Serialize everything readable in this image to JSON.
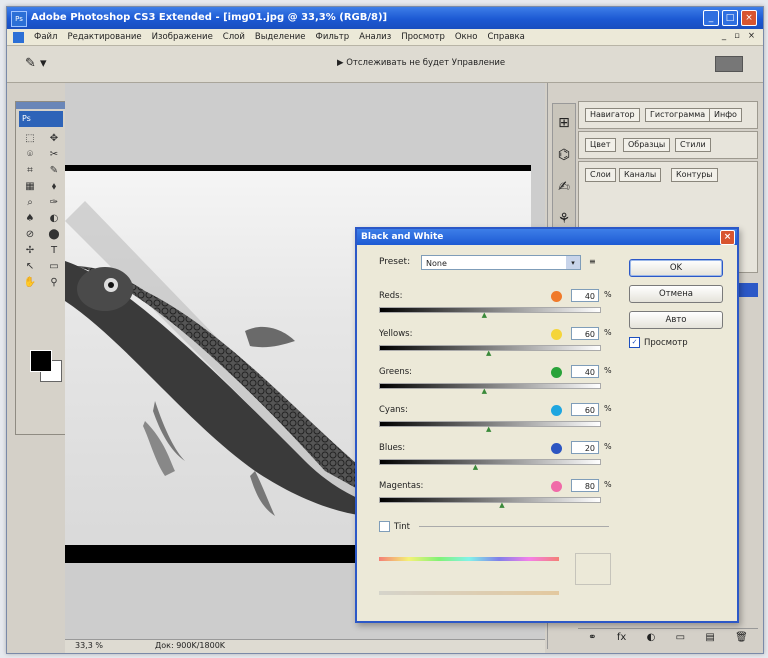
{
  "window": {
    "app_icon": "Ps",
    "title": "Adobe Photoshop CS3 Extended - [img01.jpg @ 33,3% (RGB/8)]",
    "min": "_",
    "max": "□",
    "close": "×"
  },
  "menu": {
    "items": [
      "Файл",
      "Редактирование",
      "Изображение",
      "Слой",
      "Выделение",
      "Фильтр",
      "Анализ",
      "Просмотр",
      "Окно",
      "Справка"
    ],
    "right": [
      "_",
      "▫",
      "×"
    ]
  },
  "options": {
    "tool_glyph": "✎ ▾",
    "hint": "▶ Отслеживать не будет Управление"
  },
  "toolbox": {
    "logo": "Ps",
    "tools": [
      "⬚",
      "✥",
      "⌾",
      "✂",
      "⌗",
      "✎",
      "▦",
      "⬧",
      "⌕",
      "✑",
      "♠",
      "◐",
      "⊘",
      "⬤",
      "✢",
      "T",
      "↖",
      "▭",
      "✋",
      "⚲"
    ]
  },
  "status": {
    "zoom": "33,3 %",
    "doc": "Док: 900K/1800K"
  },
  "palettes": {
    "dock_icons": [
      "⊞",
      "⌬",
      "✍",
      "⚘"
    ],
    "row1": [
      "Навигатор",
      "Гистограмма",
      "Инфо"
    ],
    "row2": [
      "Цвет",
      "Образцы",
      "Стили"
    ],
    "row3": [
      "Слои",
      "Каналы",
      "Контуры"
    ],
    "bottom_icons": [
      "⚭",
      "fx",
      "◐",
      "▭",
      "▤",
      "🗑"
    ]
  },
  "dialog": {
    "title": "Black and White",
    "close": "×",
    "preset_label": "Preset:",
    "preset_value": "None",
    "preset_arrow": "▾",
    "preset_menu": "≡",
    "channels": [
      {
        "label": "Reds:",
        "value": "40",
        "pct": "%",
        "color": "#f07a2a",
        "thumb_pct": 48
      },
      {
        "label": "Yellows:",
        "value": "60",
        "pct": "%",
        "color": "#f5d53a",
        "thumb_pct": 50
      },
      {
        "label": "Greens:",
        "value": "40",
        "pct": "%",
        "color": "#29a33a",
        "thumb_pct": 48
      },
      {
        "label": "Cyans:",
        "value": "60",
        "pct": "%",
        "color": "#1ea6e0",
        "thumb_pct": 50
      },
      {
        "label": "Blues:",
        "value": "20",
        "pct": "%",
        "color": "#2c55c2",
        "thumb_pct": 44
      },
      {
        "label": "Magentas:",
        "value": "80",
        "pct": "%",
        "color": "#f06aa8",
        "thumb_pct": 56
      }
    ],
    "buttons": {
      "ok": "OK",
      "cancel": "Отмена",
      "auto": "Авто"
    },
    "preview": {
      "check": "✓",
      "label": "Просмотр"
    },
    "tint_label": "Tint"
  }
}
